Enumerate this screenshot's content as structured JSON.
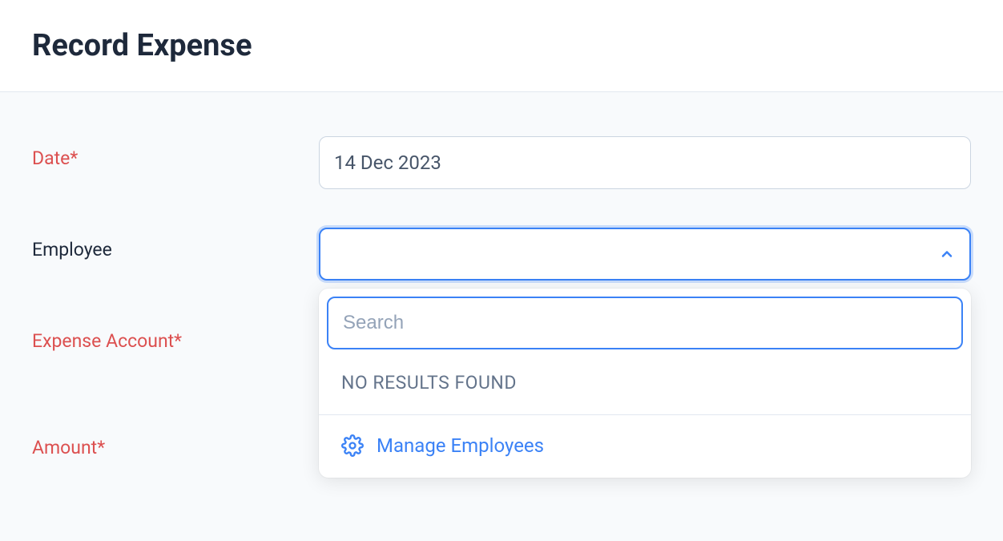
{
  "header": {
    "title": "Record Expense"
  },
  "form": {
    "date": {
      "label": "Date*",
      "value": "14 Dec 2023"
    },
    "employee": {
      "label": "Employee",
      "value": "",
      "dropdown": {
        "search_placeholder": "Search",
        "no_results": "NO RESULTS FOUND",
        "manage_label": "Manage Employees"
      }
    },
    "expense_account": {
      "label": "Expense Account*"
    },
    "amount": {
      "label": "Amount*"
    }
  }
}
